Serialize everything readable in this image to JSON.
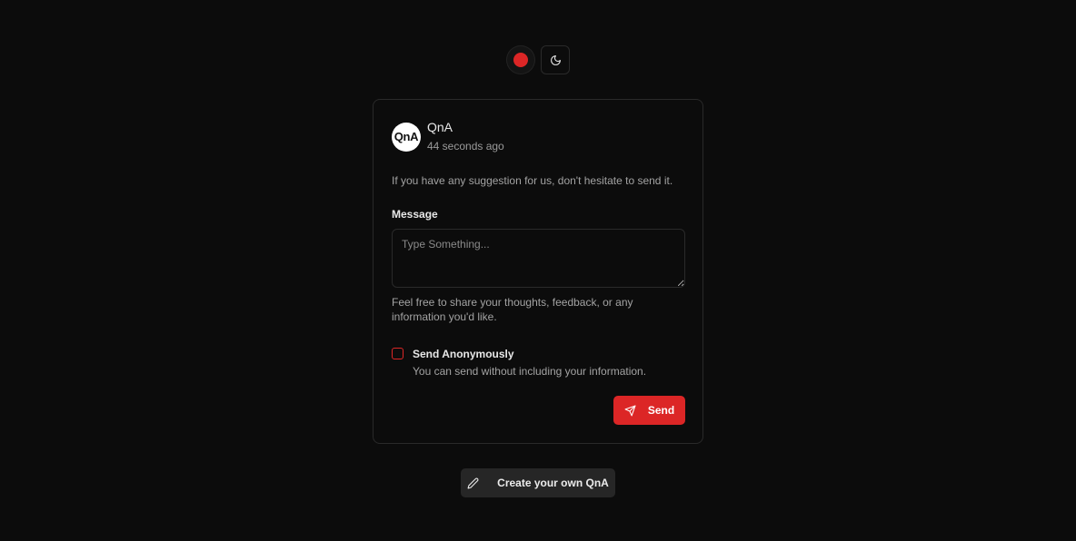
{
  "colors": {
    "background": "#0c0c0c",
    "accent": "#dc2626",
    "border": "#2a2a2a",
    "muted_text": "#a3a3a3",
    "secondary_button": "#262626"
  },
  "top_controls": {
    "record_icon": "record-dot-icon",
    "theme_icon": "moon-icon"
  },
  "card": {
    "avatar_text": "QnA",
    "app_name": "QnA",
    "timestamp": "44 seconds ago",
    "intro": "If you have any suggestion for us, don't hesitate to send it.",
    "message_label": "Message",
    "message_placeholder": "Type Something...",
    "message_value": "",
    "helper": "Feel free to share your thoughts, feedback, or any information you'd like.",
    "anonymous": {
      "title": "Send Anonymously",
      "description": "You can send without including your information.",
      "checked": false
    },
    "send_label": "Send",
    "send_icon": "send-icon"
  },
  "create_button": {
    "label": "Create your own QnA",
    "icon": "pencil-icon"
  }
}
